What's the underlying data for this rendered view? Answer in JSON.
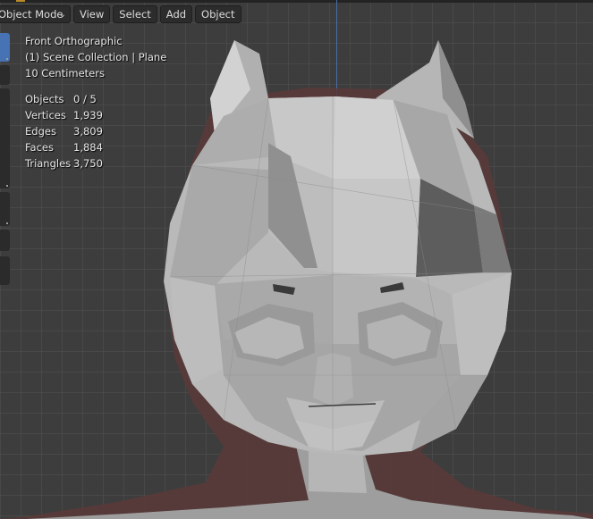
{
  "header": {
    "mode_label": "Object Mode",
    "menu": [
      "View",
      "Select",
      "Add",
      "Object"
    ]
  },
  "overlay": {
    "view_name": "Front Orthographic",
    "collection": "(1) Scene Collection | Plane",
    "scale": "10 Centimeters"
  },
  "stats": [
    {
      "label": "Objects",
      "value": "0 / 5"
    },
    {
      "label": "Vertices",
      "value": "1,939"
    },
    {
      "label": "Edges",
      "value": "3,809"
    },
    {
      "label": "Faces",
      "value": "1,884"
    },
    {
      "label": "Triangles",
      "value": "3,750"
    }
  ],
  "icons": {
    "mode_dropdown": "chevron-down-icon"
  },
  "colors": {
    "viewport_bg": "#3d3d3d",
    "active_tool": "#4772b3",
    "mesh_light": "#c4c4c4",
    "mesh_dark": "#5a5a5a",
    "axis_blue": "#4a6ea8"
  }
}
